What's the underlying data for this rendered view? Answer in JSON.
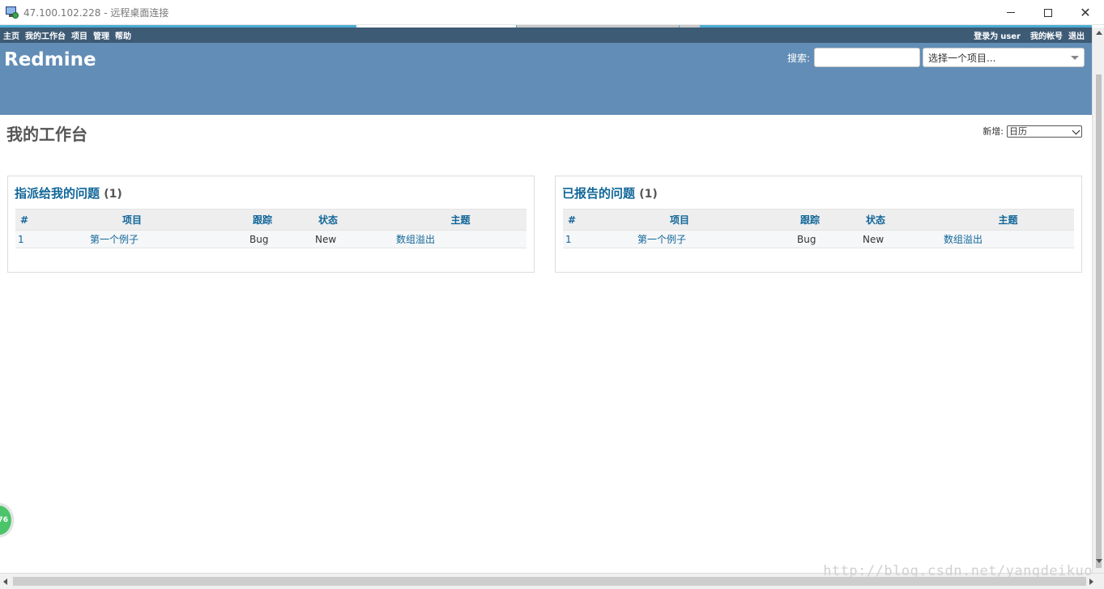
{
  "window": {
    "title": "47.100.102.228 - 远程桌面连接",
    "minimize": "",
    "maximize": "",
    "close": "✕"
  },
  "top_menu": {
    "items": [
      {
        "label": "主页"
      },
      {
        "label": "我的工作台"
      },
      {
        "label": "项目"
      },
      {
        "label": "管理"
      },
      {
        "label": "帮助"
      }
    ],
    "logged_in_prefix": "登录为",
    "user": "user",
    "my_account": "我的帐号",
    "logout": "退出"
  },
  "header": {
    "app_title": "Redmine",
    "search_label": "搜索:",
    "search_value": "",
    "project_select": "选择一个项目..."
  },
  "page": {
    "title": "我的工作台",
    "new_block_label": "新增:",
    "new_block_value": "日历"
  },
  "assigned_box": {
    "title": "指派给我的问题",
    "count": "(1)",
    "columns": [
      "#",
      "项目",
      "跟踪",
      "状态",
      "主题"
    ],
    "rows": [
      {
        "id": "1",
        "project": "第一个例子",
        "tracker": "Bug",
        "status": "New",
        "subject": "数组溢出"
      }
    ]
  },
  "reported_box": {
    "title": "已报告的问题",
    "count": "(1)",
    "columns": [
      "#",
      "项目",
      "跟踪",
      "状态",
      "主题"
    ],
    "rows": [
      {
        "id": "1",
        "project": "第一个例子",
        "tracker": "Bug",
        "status": "New",
        "subject": "数组溢出"
      }
    ]
  },
  "badge": "76",
  "watermark": "http://blog.csdn.net/yangdeikuo",
  "colors": {
    "top_menu_bg": "#3e5b76",
    "header_bg": "#628db6",
    "link": "#116699"
  }
}
